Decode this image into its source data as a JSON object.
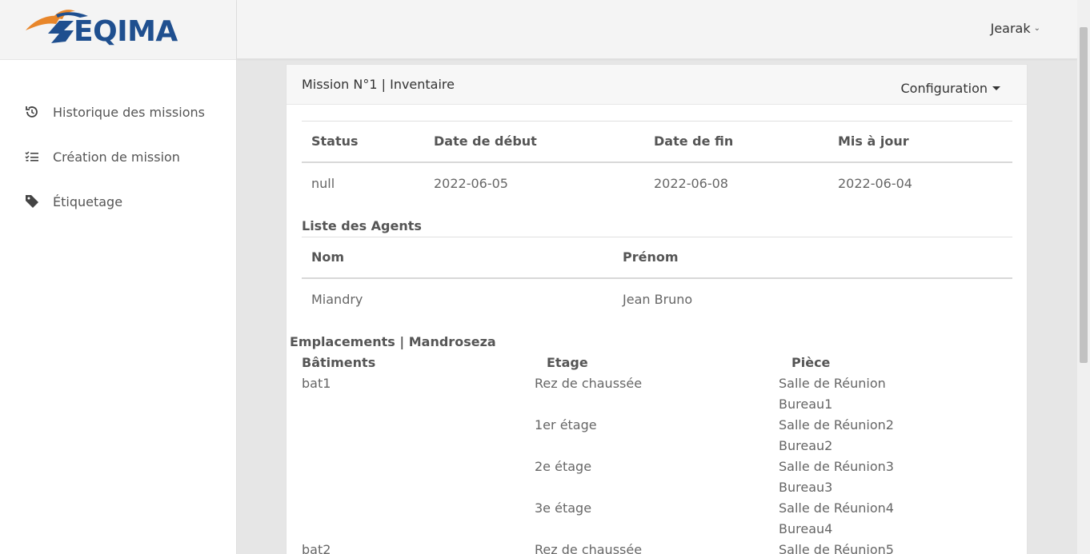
{
  "brand": {
    "name": "EQIMA",
    "colors": {
      "primary": "#1f4f8f",
      "accent": "#e8862a"
    }
  },
  "sidebar": {
    "items": [
      {
        "label": "Historique des missions",
        "icon": "history-icon"
      },
      {
        "label": "Création de mission",
        "icon": "checklist-icon"
      },
      {
        "label": "Étiquetage",
        "icon": "tag-icon"
      }
    ]
  },
  "topbar": {
    "user": "Jearak"
  },
  "mission": {
    "title": "Mission N°1 | Inventaire",
    "config_label": "Configuration",
    "status_table": {
      "headers": [
        "Status",
        "Date de début",
        "Date de fin",
        "Mis à jour"
      ],
      "row": [
        "null",
        "2022-06-05",
        "2022-06-08",
        "2022-06-04"
      ]
    },
    "agents_title": "Liste des Agents",
    "agents_table": {
      "headers": [
        "Nom",
        "Prénom"
      ],
      "rows": [
        [
          "Miandry",
          "Jean Bruno"
        ]
      ]
    },
    "locations_title": "Emplacements | Mandroseza",
    "locations": {
      "headers": [
        "Bâtiments",
        "Etage",
        "Pièce"
      ],
      "rows": [
        [
          "bat1",
          "Rez de chaussée",
          "Salle de Réunion"
        ],
        [
          "",
          "",
          "Bureau1"
        ],
        [
          "",
          "1er étage",
          "Salle de Réunion2"
        ],
        [
          "",
          "",
          "Bureau2"
        ],
        [
          "",
          "2e étage",
          "Salle de Réunion3"
        ],
        [
          "",
          "",
          "Bureau3"
        ],
        [
          "",
          "3e étage",
          "Salle de Réunion4"
        ],
        [
          "",
          "",
          "Bureau4"
        ],
        [
          "bat2",
          "Rez de chaussée",
          "Salle de Réunion5"
        ]
      ]
    }
  }
}
